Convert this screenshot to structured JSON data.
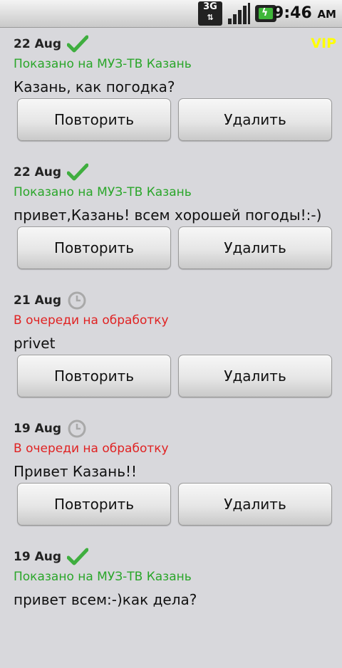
{
  "status_bar": {
    "network": "3G",
    "time": "9:46",
    "ampm": "AM",
    "battery_color": "#3fb73a"
  },
  "vip_label": "VIP",
  "colors": {
    "shown": "#2aa62a",
    "queued": "#e02222",
    "vip": "#ffff00"
  },
  "button_labels": {
    "repeat": "Повторить",
    "delete": "Удалить"
  },
  "messages": [
    {
      "date": "22 Aug",
      "status": "Показано на МУЗ-ТВ Казань",
      "status_type": "shown",
      "status_icon": "checkmark-icon",
      "text": "Казань, как погодка?"
    },
    {
      "date": "22 Aug",
      "status": "Показано на МУЗ-ТВ Казань",
      "status_type": "shown",
      "status_icon": "checkmark-icon",
      "text": "привет,Казань! всем хорошей погоды!:-)"
    },
    {
      "date": "21 Aug",
      "status": "В очереди на обработку",
      "status_type": "queued",
      "status_icon": "clock-icon",
      "text": "privet"
    },
    {
      "date": "19 Aug",
      "status": "В очереди на обработку",
      "status_type": "queued",
      "status_icon": "clock-icon",
      "text": "Привет Казань!!"
    },
    {
      "date": "19 Aug",
      "status": "Показано на МУЗ-ТВ Казань",
      "status_type": "shown",
      "status_icon": "checkmark-icon",
      "text": "привет всем:-)как дела?"
    }
  ]
}
